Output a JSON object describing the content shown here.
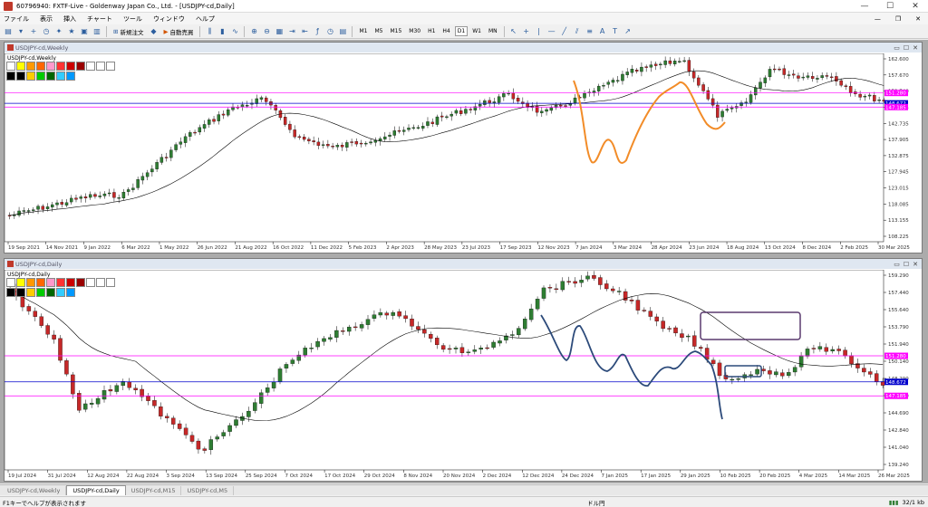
{
  "window": {
    "title": "60796940: FXTF-Live - Goldenway Japan Co., Ltd. - [USDJPY-cd,Daily]"
  },
  "menu": [
    "ファイル",
    "表示",
    "挿入",
    "チャート",
    "ツール",
    "ウィンドウ",
    "ヘルプ"
  ],
  "toolbar": {
    "new_order": "新規注文",
    "auto_trade": "自動売買",
    "timeframes": [
      "M1",
      "M5",
      "M15",
      "M30",
      "H1",
      "H4",
      "D1",
      "W1",
      "MN"
    ],
    "active_timeframe": "D1"
  },
  "weekly": {
    "title": "USDJPY-cd,Weekly",
    "symbol": "USDJPY-cd,Weekly",
    "y_ticks": [
      "162.600",
      "157.670",
      "152.740",
      "147.805",
      "142.735",
      "137.905",
      "132.875",
      "127.945",
      "123.015",
      "118.085",
      "113.155",
      "108.225"
    ],
    "price_labels": [
      {
        "text": "151.280",
        "color": "#ff00ff"
      },
      {
        "text": "148.672",
        "color": "#0000cc"
      },
      {
        "text": "147.185",
        "color": "#ff00ff"
      }
    ],
    "x_ticks": [
      "19 Sep 2021",
      "14 Nov 2021",
      "9 Jan 2022",
      "6 Mar 2022",
      "1 May 2022",
      "26 Jun 2022",
      "21 Aug 2022",
      "16 Oct 2022",
      "11 Dec 2022",
      "5 Feb 2023",
      "2 Apr 2023",
      "28 May 2023",
      "23 Jul 2023",
      "17 Sep 2023",
      "12 Nov 2023",
      "7 Jan 2024",
      "3 Mar 2024",
      "28 Apr 2024",
      "23 Jun 2024",
      "18 Aug 2024",
      "13 Oct 2024",
      "8 Dec 2024",
      "2 Feb 2025",
      "30 Mar 2025"
    ]
  },
  "daily": {
    "title": "USDJPY-cd,Daily",
    "symbol": "USDJPY-cd,Daily",
    "y_ticks": [
      "159.290",
      "157.440",
      "155.640",
      "153.790",
      "151.940",
      "150.140",
      "148.290",
      "146.440",
      "144.690",
      "142.840",
      "141.040",
      "139.240"
    ],
    "price_labels": [
      {
        "text": "151.280",
        "color": "#ff00ff"
      },
      {
        "text": "148.672",
        "color": "#0000cc"
      },
      {
        "text": "147.185",
        "color": "#ff00ff"
      }
    ],
    "x_ticks": [
      "19 Jul 2024",
      "31 Jul 2024",
      "12 Aug 2024",
      "22 Aug 2024",
      "3 Sep 2024",
      "13 Sep 2024",
      "25 Sep 2024",
      "7 Oct 2024",
      "17 Oct 2024",
      "29 Oct 2024",
      "8 Nov 2024",
      "20 Nov 2024",
      "2 Dec 2024",
      "12 Dec 2024",
      "24 Dec 2024",
      "7 Jan 2025",
      "17 Jan 2025",
      "29 Jan 2025",
      "10 Feb 2025",
      "20 Feb 2025",
      "4 Mar 2025",
      "14 Mar 2025",
      "26 Mar 2025"
    ]
  },
  "tabs": [
    "USDJPY-cd,Weekly",
    "USDJPY-cd,Daily",
    "USDJPY-cd,M15",
    "USDJPY-cd,M5"
  ],
  "active_tab": "USDJPY-cd,Daily",
  "status": {
    "help": "F1キーでヘルプが表示されます",
    "profile": "ドル円",
    "traffic": "32/1 kb"
  },
  "colors": {
    "bull": "#2e7d32",
    "bear": "#c62828",
    "ma": "#000000",
    "magenta_line": "#ff00ff",
    "blue_line": "#0000cc",
    "orange_draw": "#f28c28",
    "blue_draw": "#2c4a7a",
    "purple_box": "#5a3a6e"
  }
}
